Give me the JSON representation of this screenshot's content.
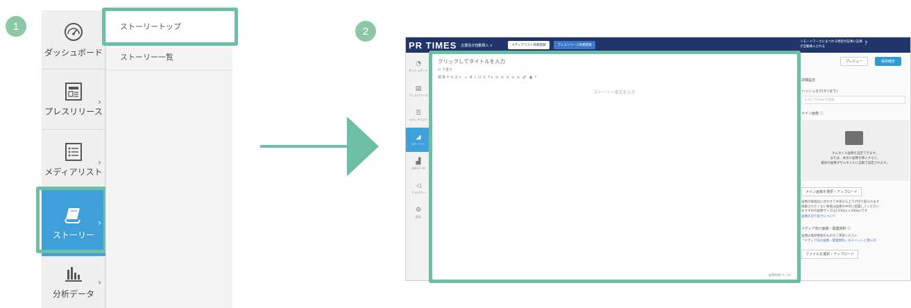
{
  "steps": {
    "step1": "1",
    "step2": "2"
  },
  "panel1": {
    "nav": [
      {
        "label": "ダッシュボード",
        "icon": "dashboard-gauge-icon"
      },
      {
        "label": "プレスリリース",
        "icon": "press-release-newspaper-icon"
      },
      {
        "label": "メディアリスト",
        "icon": "media-list-icon"
      },
      {
        "label": "ストーリー",
        "icon": "story-book-icon"
      },
      {
        "label": "分析データ",
        "icon": "bar-chart-icon"
      }
    ],
    "submenu": [
      {
        "label": "ストーリートップ"
      },
      {
        "label": "ストーリー一覧"
      }
    ]
  },
  "panel2": {
    "logo": "PR TIMES",
    "company": "企業名が自動挿入 ∨",
    "top_buttons": [
      "メディアリスト新規登録",
      "プレスリリース新規登録"
    ],
    "top_notice": "リモートワークにまつわる特定の記事に記事が自動挿入される",
    "mini_nav": [
      "ダッシュボード",
      "プレスリリース",
      "メディアリスト",
      "ストーリー",
      "分析データ",
      "フォロワー",
      "設定"
    ],
    "editor": {
      "title_placeholder": "クリックしてタイトルを入力",
      "draft_check": "下書き",
      "toolbar": "標準テキスト ÷  B  I  U  S   Tx   ≡ ≡   ≡ ≡ ≡   🔗 ▣   ❞",
      "body_placeholder": "ストーリー本文を入力",
      "char_count": "画像枚数 0 / 20"
    },
    "right": {
      "preview_label": "プレビュー",
      "save_label": "保存確定",
      "detail_heading": "詳細設定",
      "hashtag_label": "ハッシュタグ(3つまで)",
      "hashtag_placeholder": "入力してEnterで追加",
      "main_image_label": "メイン画像 ⓘ",
      "image_text": "サムネイル画像を設定できます。\nまたは、本文に画像を挿入すると、\n最初の画像がサムネイルに自動で設定されます。",
      "main_image_button": "メイン画像を選択・アップロード",
      "image_note": "画像の縦幅比に合わせて中央から上下が切り取られます\n掲載されたくない要素は画像の中央に配置してください\nおすすめの画像サイズは1200px x 680pxです",
      "image_note_link": "画像の切り抜きについて",
      "media_label": "メディア向け画像・関連資料 ⓘ",
      "media_note": "画像は無修整版のものをご用意ください",
      "media_link": "「メディア向け画像・関連資料」のメリットと使い方",
      "file_button": "ファイルを選択・アップロード"
    }
  }
}
